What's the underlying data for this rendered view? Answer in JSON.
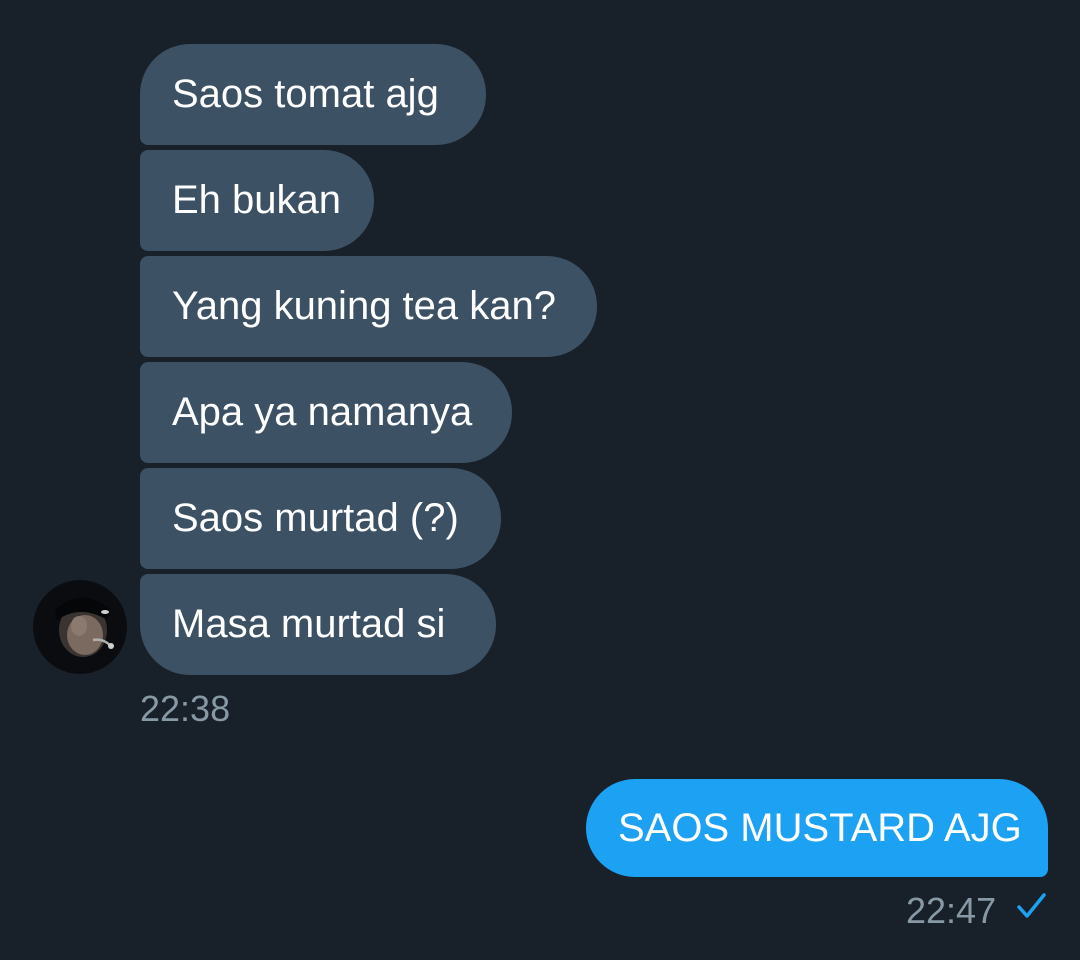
{
  "conversation": {
    "received_messages": [
      {
        "text": "Saos tomat ajg"
      },
      {
        "text": "Eh bukan"
      },
      {
        "text": "Yang kuning tea kan?"
      },
      {
        "text": "Apa ya namanya"
      },
      {
        "text": "Saos murtad (?)"
      },
      {
        "text": "Masa murtad si"
      }
    ],
    "received_time": "22:38",
    "sent_messages": [
      {
        "text": "SAOS MUSTARD AJG"
      }
    ],
    "sent_time": "22:47",
    "sender_avatar_icon": "avatar-photo",
    "read_status_icon": "checkmark-icon"
  },
  "colors": {
    "background": "#18202a",
    "received_bubble": "#3c5163",
    "sent_bubble": "#1da1f2",
    "timestamp": "#8899a6",
    "checkmark": "#1da1f2"
  }
}
